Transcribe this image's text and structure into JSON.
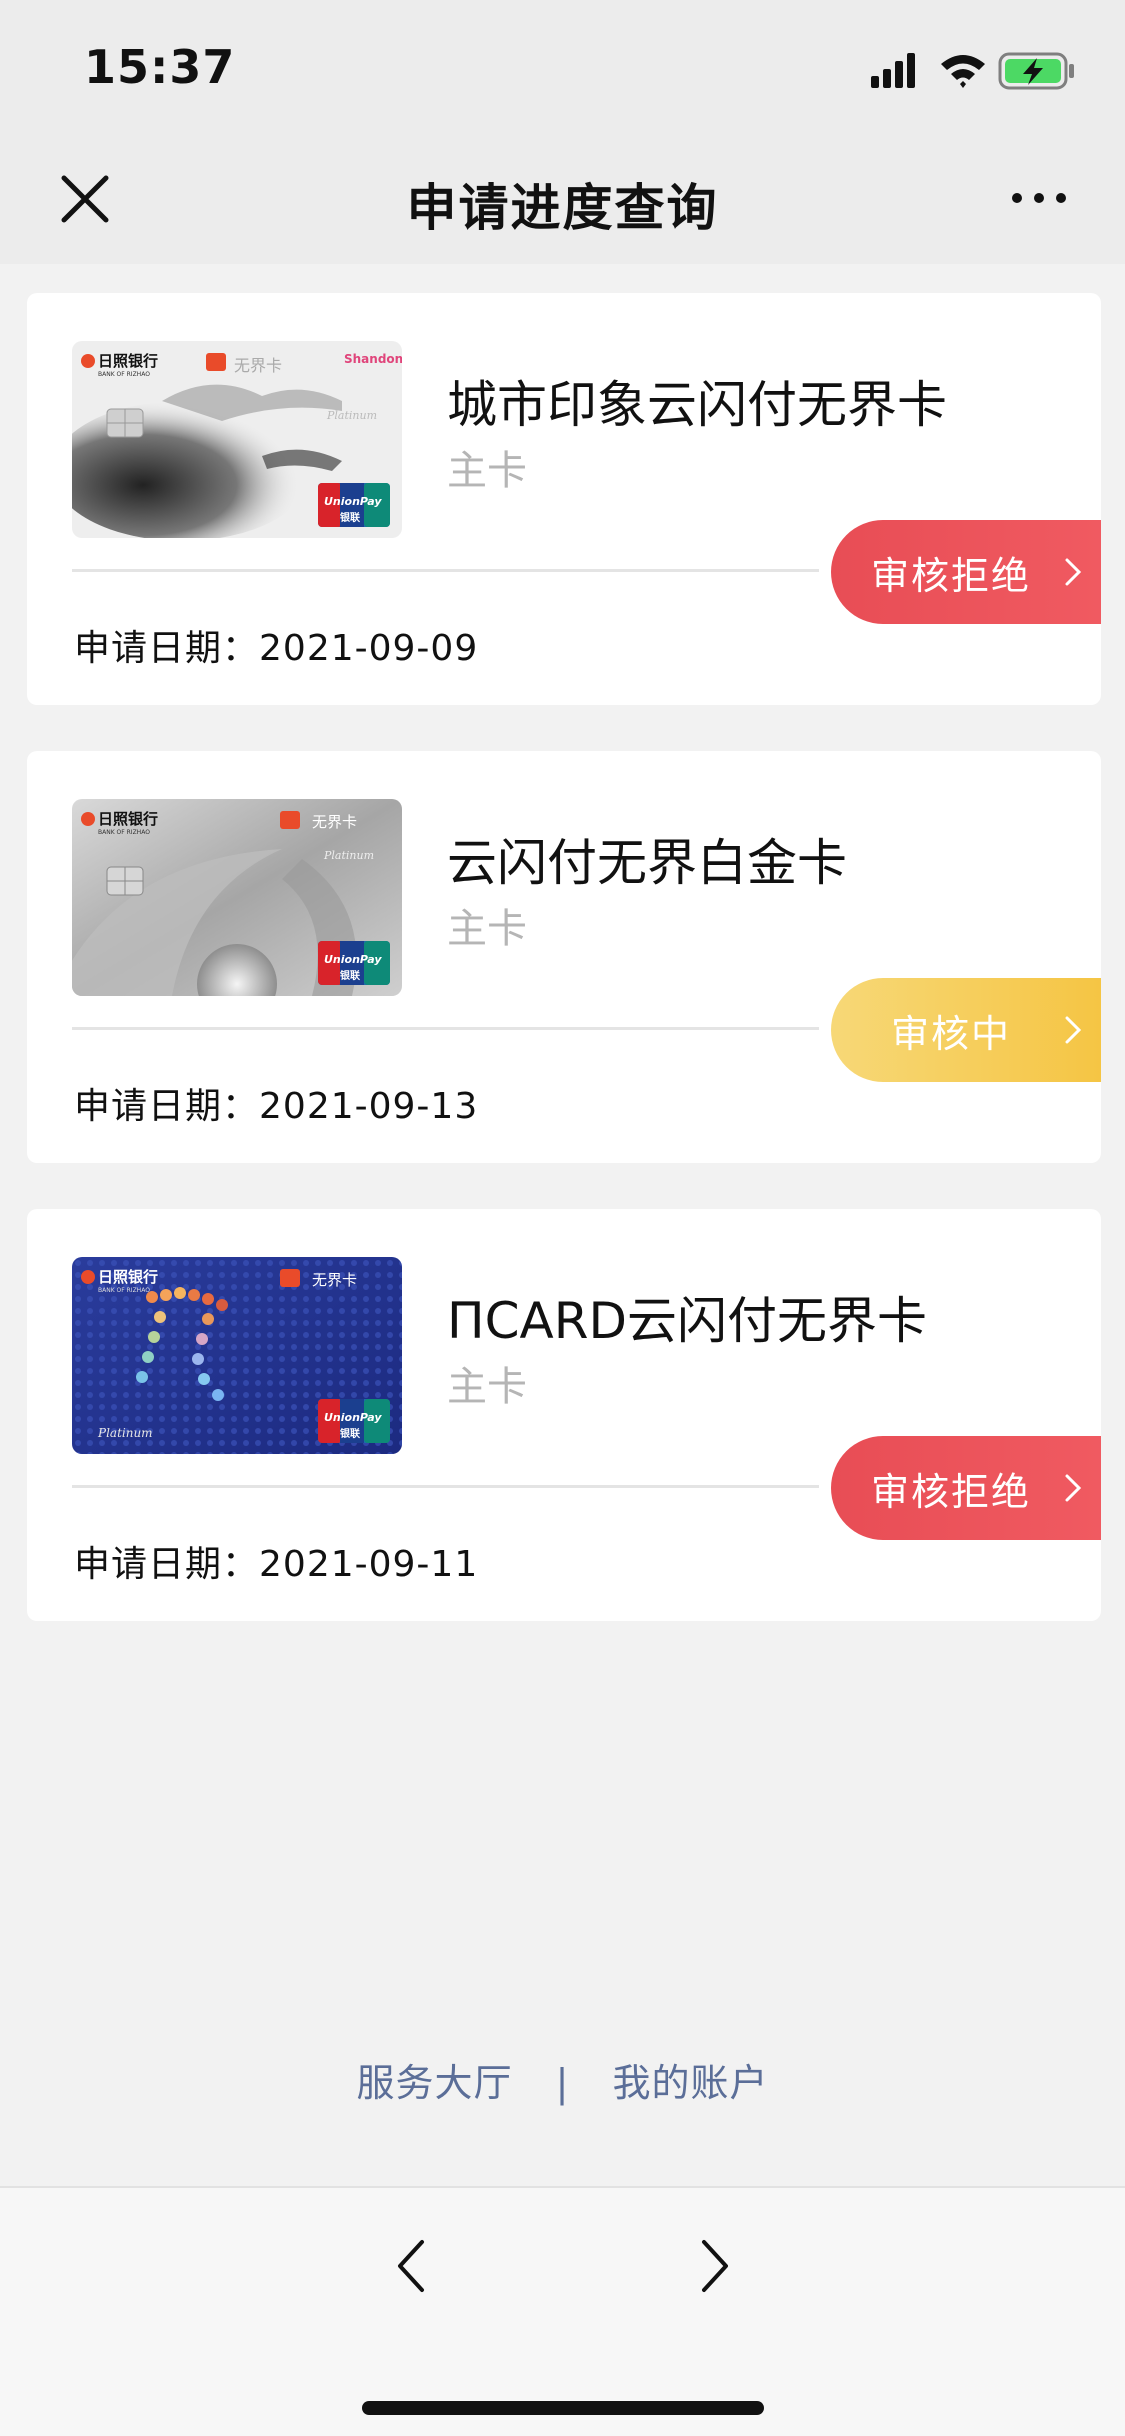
{
  "status_bar": {
    "time": "15:37"
  },
  "nav": {
    "title": "申请进度查询"
  },
  "applications": [
    {
      "name": "城市印象云闪付无界卡",
      "type": "主卡",
      "date_label": "申请日期：",
      "date": "2021-09-09",
      "status": "审核拒绝",
      "status_color": "#ee545c",
      "card_bank": "日照银行",
      "card_bank_en": "BANK OF RIZHAO",
      "card_tag": "无界卡",
      "card_brand": "UnionPay",
      "card_brand_cn": "银联",
      "card_tier": "Platinum",
      "card_extra": "Shandong"
    },
    {
      "name": "云闪付无界白金卡",
      "type": "主卡",
      "date_label": "申请日期：",
      "date": "2021-09-13",
      "status": "审核中",
      "status_color": "#f6cd5c",
      "card_bank": "日照银行",
      "card_bank_en": "BANK OF RIZHAO",
      "card_tag": "无界卡",
      "card_brand": "UnionPay",
      "card_brand_cn": "银联",
      "card_tier": "Platinum"
    },
    {
      "name": "ΠCARD云闪付无界卡",
      "type": "主卡",
      "date_label": "申请日期：",
      "date": "2021-09-11",
      "status": "审核拒绝",
      "status_color": "#ee545c",
      "card_bank": "日照银行",
      "card_bank_en": "BANK OF RIZHAO",
      "card_tag": "无界卡",
      "card_brand": "UnionPay",
      "card_brand_cn": "银联",
      "card_tier": "Platinum"
    }
  ],
  "footer": {
    "link_service": "服务大厅",
    "separator": "|",
    "link_account": "我的账户"
  }
}
